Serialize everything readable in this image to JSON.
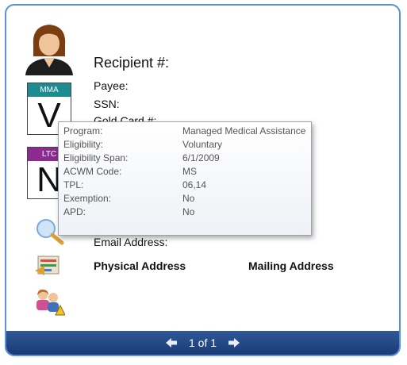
{
  "recipient": {
    "title": "Recipient #:",
    "fields": [
      "Payee:",
      "SSN:",
      "Gold Card #:"
    ],
    "email_label": "Email Address:",
    "physical_address_label": "Physical Address",
    "mailing_address_label": "Mailing Address"
  },
  "badges": [
    {
      "header": "MMA",
      "letter": "V",
      "color": "#1d8b8f"
    },
    {
      "header": "LTC",
      "letter": "N",
      "color": "#8b2a8f"
    }
  ],
  "tooltip": {
    "rows": [
      {
        "key": "Program:",
        "value": "Managed Medical Assistance"
      },
      {
        "key": "Eligibility:",
        "value": "Voluntary"
      },
      {
        "key": "Eligibility Span:",
        "value": "6/1/2009"
      },
      {
        "key": "ACWM Code:",
        "value": "MS"
      },
      {
        "key": "TPL:",
        "value": "06,14"
      },
      {
        "key": "Exemption:",
        "value": "No"
      },
      {
        "key": "APD:",
        "value": "No"
      }
    ]
  },
  "pager": {
    "text": "1 of 1"
  },
  "icons": [
    "person-avatar-icon",
    "search-icon",
    "address-card-icon",
    "family-warning-icon",
    "left-arrow-icon",
    "right-arrow-icon"
  ]
}
